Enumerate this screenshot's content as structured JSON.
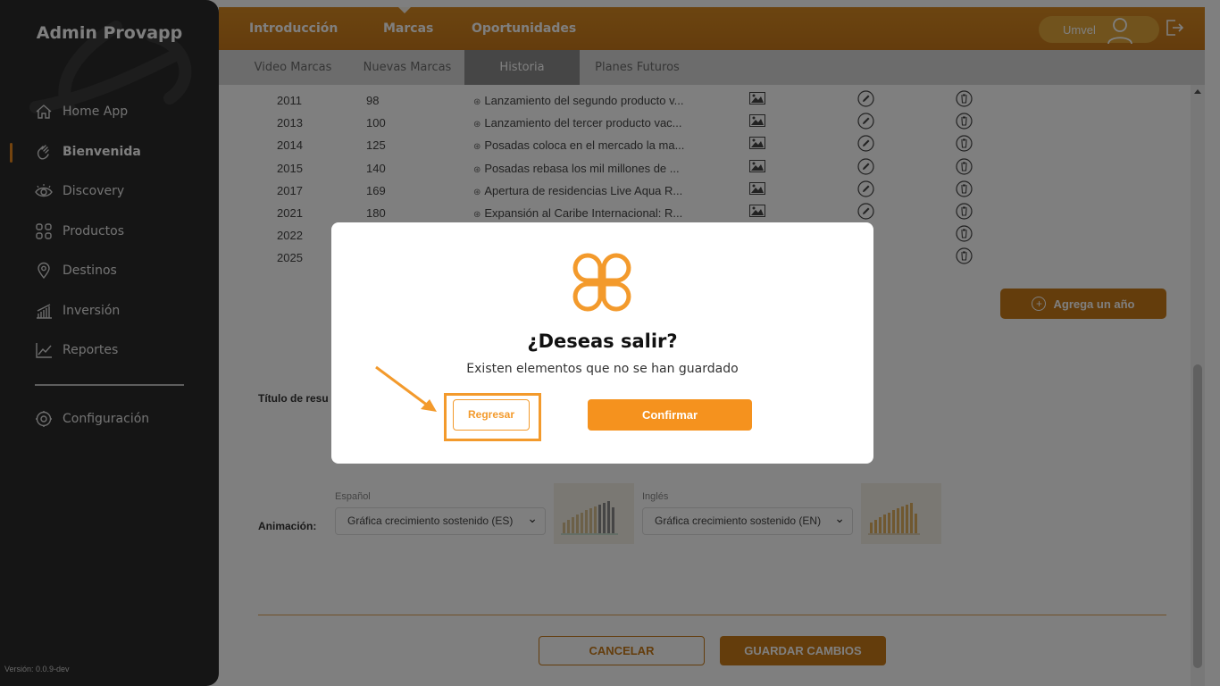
{
  "sidebar": {
    "brand": "Admin Provapp",
    "items": [
      {
        "label": "Home App",
        "icon": "home-icon"
      },
      {
        "label": "Bienvenida",
        "icon": "waving-hand-icon"
      },
      {
        "label": "Discovery",
        "icon": "eye-icon"
      },
      {
        "label": "Productos",
        "icon": "grid-icon"
      },
      {
        "label": "Destinos",
        "icon": "map-pin-icon"
      },
      {
        "label": "Inversión",
        "icon": "bar-chart-icon"
      },
      {
        "label": "Reportes",
        "icon": "line-chart-icon"
      }
    ],
    "config_label": "Configuración",
    "version": "Versión: 0.0.9-dev"
  },
  "topbar": {
    "tabs": [
      "Introducción",
      "Marcas",
      "Oportunidades"
    ],
    "active_tab": "Marcas",
    "user_name": "Umvel"
  },
  "subtabs": [
    "Video Marcas",
    "Nuevas Marcas",
    "Historia",
    "Planes Futuros"
  ],
  "active_subtab": "Historia",
  "history_rows": [
    {
      "year": "2011",
      "value": "98",
      "desc": "Lanzamiento del segundo producto v..."
    },
    {
      "year": "2013",
      "value": "100",
      "desc": "Lanzamiento del tercer producto vac..."
    },
    {
      "year": "2014",
      "value": "125",
      "desc": "Posadas coloca en el mercado la ma..."
    },
    {
      "year": "2015",
      "value": "140",
      "desc": "Posadas rebasa los mil millones de ..."
    },
    {
      "year": "2017",
      "value": "169",
      "desc": "Apertura de residencias Live Aqua R..."
    },
    {
      "year": "2021",
      "value": "180",
      "desc": "Expansión al Caribe Internacional: R..."
    },
    {
      "year": "2022",
      "value": "",
      "desc": ""
    },
    {
      "year": "2025",
      "value": "",
      "desc": ""
    }
  ],
  "add_year_label": "Agrega un año",
  "summary_title_label": "Título de resu",
  "animation": {
    "label": "Animación:",
    "es_caption": "Español",
    "es_value": "Gráfica crecimiento sostenido (ES)",
    "en_caption": "Inglés",
    "en_value": "Gráfica crecimiento sostenido (EN)"
  },
  "footer": {
    "cancel_label": "CANCELAR",
    "save_label": "GUARDAR CAMBIOS"
  },
  "modal": {
    "title": "¿Deseas salir?",
    "text": "Existen elementos que no se han guardado",
    "back_label": "Regresar",
    "confirm_label": "Confirmar"
  },
  "colors": {
    "accent": "#c97b19",
    "modal_accent": "#f5921e",
    "sidebar_bg": "#2b2b2b"
  }
}
